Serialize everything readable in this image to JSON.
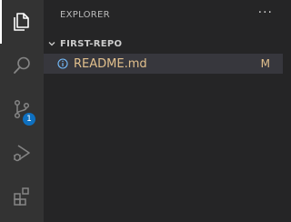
{
  "activity_bar": {
    "items": [
      {
        "name": "explorer",
        "icon": "files-icon",
        "active": true
      },
      {
        "name": "search",
        "icon": "search-icon",
        "active": false
      },
      {
        "name": "source-control",
        "icon": "source-control-icon",
        "active": false,
        "badge": "1"
      },
      {
        "name": "run-debug",
        "icon": "run-debug-icon",
        "active": false
      },
      {
        "name": "extensions",
        "icon": "extensions-icon",
        "active": false
      }
    ],
    "badge_color": "#0e70c0"
  },
  "sidebar": {
    "title": "EXPLORER",
    "more_actions": "···",
    "section": {
      "label": "FIRST-REPO",
      "expanded": true
    },
    "files": [
      {
        "name": "README.md",
        "status": "M",
        "icon": "info-icon",
        "color": "#e2c08d"
      }
    ]
  }
}
